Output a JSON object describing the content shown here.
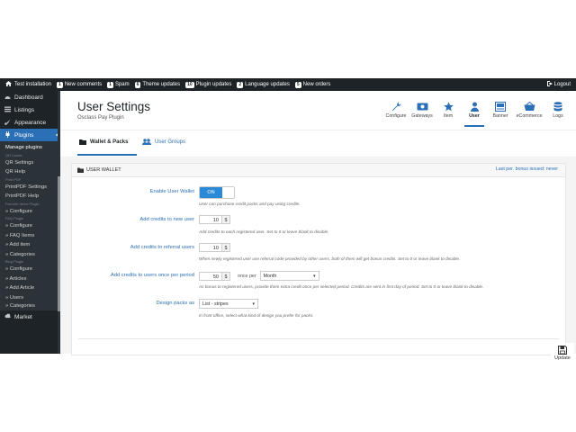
{
  "topbar": {
    "items": [
      {
        "label": "Test installation",
        "badge": ""
      },
      {
        "label": "New comments",
        "badge": "1"
      },
      {
        "label": "Spam",
        "badge": "1"
      },
      {
        "label": "Theme updates",
        "badge": "6"
      },
      {
        "label": "Plugin updates",
        "badge": "10"
      },
      {
        "label": "Language updates",
        "badge": "2"
      },
      {
        "label": "New orders",
        "badge": "5"
      }
    ],
    "logout": "Logout"
  },
  "sidebar": {
    "main_items": [
      "Dashboard",
      "Listings",
      "Appearance",
      "Plugins"
    ],
    "sub_items": [
      {
        "type": "item",
        "label": "Manage plugins"
      },
      {
        "type": "group",
        "label": "QR Codes"
      },
      {
        "type": "item",
        "label": "QR Settings"
      },
      {
        "type": "item",
        "label": "QR Help"
      },
      {
        "type": "group",
        "label": "Print PDF"
      },
      {
        "type": "item",
        "label": "PrintPDF Settings"
      },
      {
        "type": "item",
        "label": "PrintPDF Help"
      },
      {
        "type": "group",
        "label": "Favorite Items Plugin"
      },
      {
        "type": "item",
        "label": "» Configure"
      },
      {
        "type": "group",
        "label": "FAQ Plugin"
      },
      {
        "type": "item",
        "label": "» Configure"
      },
      {
        "type": "item",
        "label": "» FAQ Items"
      },
      {
        "type": "item",
        "label": "» Add item"
      },
      {
        "type": "item",
        "label": "» Categories"
      },
      {
        "type": "group",
        "label": "Blog Plugin"
      },
      {
        "type": "item",
        "label": "» Configure"
      },
      {
        "type": "item",
        "label": "» Articles"
      },
      {
        "type": "item",
        "label": "» Add Article"
      },
      {
        "type": "item",
        "label": "» Users"
      },
      {
        "type": "item",
        "label": "» Categories"
      }
    ],
    "bottom_item": "Market"
  },
  "header": {
    "title": "User Settings",
    "subtitle": "Osclass Pay Plugin",
    "nav": [
      "Configure",
      "Gateways",
      "Item",
      "User",
      "Banner",
      "eCommerce",
      "Logs"
    ],
    "active_nav": "User"
  },
  "tabs": {
    "wallet": "Wallet & Packs",
    "groups": "User Groups"
  },
  "panel": {
    "title": "USER WALLET",
    "status": "Last per. bonus issued: never",
    "enable_label": "Enable User Wallet",
    "enable_value": "ON",
    "enable_help": "User can purchase credit packs and pay using credits.",
    "new_user_label": "Add credits to new user",
    "new_user_value": "10",
    "new_user_unit": "$",
    "new_user_help": "Add credits to each registered user. Set to 0 or leave blank to disable.",
    "referral_label": "Add credits to referral users",
    "referral_value": "10",
    "referral_unit": "$",
    "referral_help": "When newly registered user use referral code provided by other users, both of them will get bonus credits. Set to 0 or leave blank to disable.",
    "period_label": "Add credits to users once per period",
    "period_value": "50",
    "period_unit": "$",
    "period_per": "once per",
    "period_select": "Month",
    "period_help": "As bonus to registered users, provide them extra credit once per selected period. Credits are sent in first day of period. Set to 0 or leave blank to disable.",
    "design_label": "Design packs as",
    "design_select": "List - stripes",
    "design_help": "In front office, select what kind of design you prefer for packs.",
    "update": "Update"
  },
  "colors": {
    "accent": "#2b6fb6",
    "sidebar": "#1d2327",
    "toggle_on": "#2b8ad8"
  }
}
